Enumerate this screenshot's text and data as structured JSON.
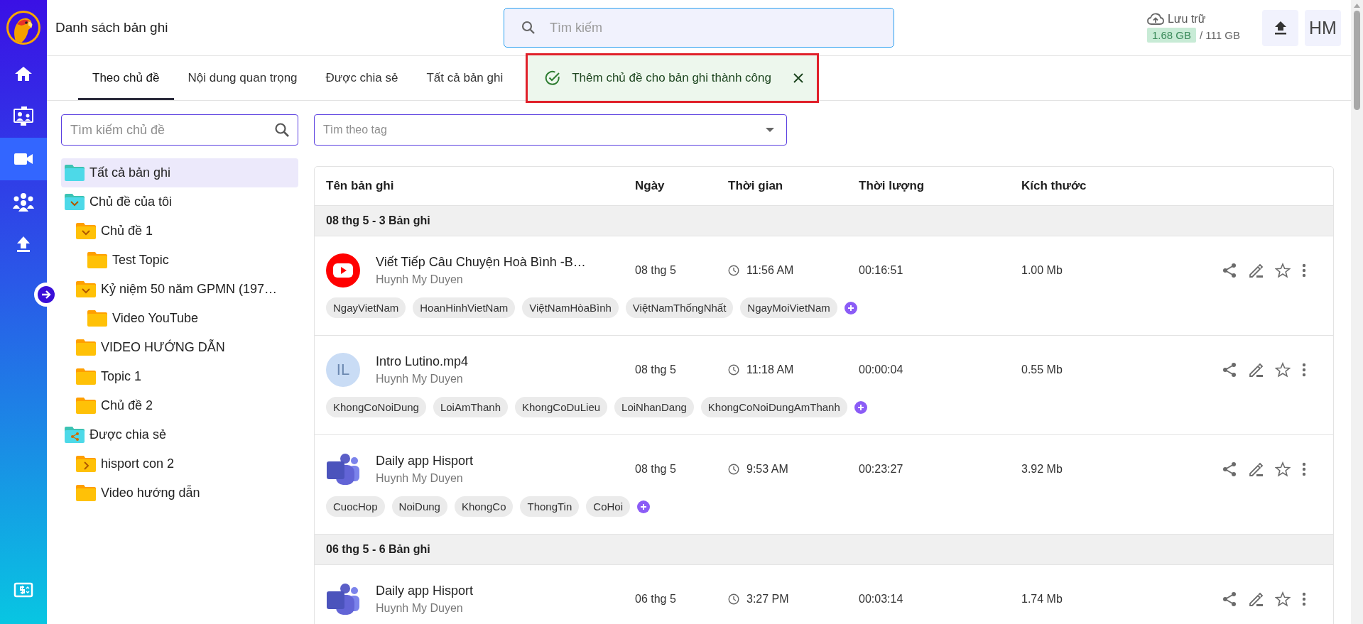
{
  "nav": [
    {
      "selected": false
    },
    {
      "selected": false
    },
    {
      "selected": true
    },
    {
      "selected": false
    },
    {
      "selected": false
    },
    {
      "selected": false
    }
  ],
  "header": {
    "title": "Danh sách bản ghi",
    "search": {
      "placeholder": "Tìm kiếm"
    },
    "storage": {
      "label": "Lưu trữ",
      "used": "1.68 GB",
      "total": "/ 111 GB"
    },
    "avatar": "HM"
  },
  "tabs": [
    {
      "label": "Theo chủ đề",
      "selected": true
    },
    {
      "label": "Nội dung quan trọng",
      "selected": false
    },
    {
      "label": "Được chia sẻ",
      "selected": false
    },
    {
      "label": "Tất cả bản ghi",
      "selected": false
    }
  ],
  "toast": {
    "message": "Thêm chủ đề cho bản ghi thành công"
  },
  "topic_search": {
    "placeholder": "Tìm kiếm chủ đề"
  },
  "tree": [
    {
      "label": "Tất cả bản ghi",
      "kind": "all",
      "selected": true
    },
    {
      "label": "Chủ đề của tôi",
      "kind": "group",
      "expanded": true,
      "selected": false,
      "children": [
        {
          "label": "Chủ đề 1",
          "kind": "folder",
          "expanded": true,
          "selected": false,
          "children": [
            {
              "label": "Test Topic",
              "kind": "folder",
              "selected": false
            }
          ]
        },
        {
          "label": "Kỷ niệm 50 năm GPMN (197…",
          "kind": "folder",
          "expanded": true,
          "selected": false,
          "children": [
            {
              "label": "Video YouTube",
              "kind": "folder",
              "selected": false
            }
          ]
        },
        {
          "label": "VIDEO HƯỚNG DẪN",
          "kind": "folder",
          "selected": false
        },
        {
          "label": "Topic 1",
          "kind": "folder",
          "selected": false
        },
        {
          "label": "Chủ đề 2",
          "kind": "folder",
          "selected": false
        }
      ]
    },
    {
      "label": "Được chia sẻ",
      "kind": "shared",
      "selected": false,
      "children": [
        {
          "label": "hisport con 2",
          "kind": "folder",
          "expanded": false,
          "selected": false
        },
        {
          "label": "Video hướng dẫn",
          "kind": "folder",
          "selected": false
        }
      ]
    }
  ],
  "tag_filter": {
    "placeholder": "Tìm theo tag"
  },
  "table": {
    "columns": [
      "Tên bản ghi",
      "Ngày",
      "Thời gian",
      "Thời lượng",
      "Kích thước"
    ],
    "rows": [
      {
        "kind": "group",
        "label": "08 thg 5 - 3 Bản ghi"
      },
      {
        "kind": "recording",
        "thumbnail": {
          "kind": "youtube"
        },
        "title": "Viết Tiếp Câu Chuyện Hoà Bình -B…",
        "owner": "Huynh My Duyen",
        "date": "08 thg 5",
        "time": "11:56 AM",
        "duration": "00:16:51",
        "size": "1.00 Mb",
        "tags": [
          "NgayVietNam",
          "HoanHinhVietNam",
          "ViệtNamHòaBình",
          "ViệtNamThốngNhất",
          "NgayMoiVietNam"
        ]
      },
      {
        "kind": "recording",
        "thumbnail": {
          "kind": "avatar",
          "initials": "IL"
        },
        "title": "Intro Lutino.mp4",
        "owner": "Huynh My Duyen",
        "date": "08 thg 5",
        "time": "11:18 AM",
        "duration": "00:00:04",
        "size": "0.55 Mb",
        "tags": [
          "KhongCoNoiDung",
          "LoiAmThanh",
          "KhongCoDuLieu",
          "LoiNhanDang",
          "KhongCoNoiDungAmThanh"
        ]
      },
      {
        "kind": "recording",
        "thumbnail": {
          "kind": "teams"
        },
        "title": "Daily app Hisport",
        "owner": "Huynh My Duyen",
        "date": "08 thg 5",
        "time": "9:53 AM",
        "duration": "00:23:27",
        "size": "3.92 Mb",
        "tags": [
          "CuocHop",
          "NoiDung",
          "KhongCo",
          "ThongTin",
          "CoHoi"
        ]
      },
      {
        "kind": "group",
        "label": "06 thg 5 - 6 Bản ghi"
      },
      {
        "kind": "recording",
        "thumbnail": {
          "kind": "teams"
        },
        "title": "Daily app Hisport",
        "owner": "Huynh My Duyen",
        "date": "06 thg 5",
        "time": "3:27 PM",
        "duration": "00:03:14",
        "size": "1.74 Mb",
        "tags": []
      }
    ]
  }
}
